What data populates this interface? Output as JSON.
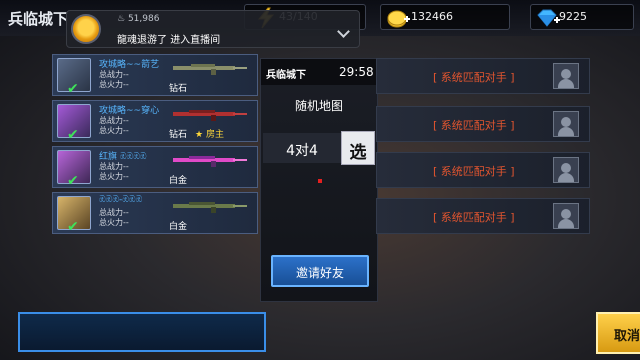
{
  "header": {
    "title": "兵临城下",
    "resources": {
      "stamina": "43/140",
      "gold": "132466",
      "diamond": "9225"
    },
    "resource_icons": [
      "lightning-icon",
      "gold-coin-icon",
      "diamond-icon"
    ]
  },
  "notification": {
    "viewer_count": "51,986",
    "user": "龍魂退游了",
    "action": "进入直播间"
  },
  "players": [
    {
      "name": "攻城略~~箭艺",
      "power_label": "总战力--",
      "fire_label": "总火力--",
      "rank": "钻石",
      "host": ""
    },
    {
      "name": "攻城略~~穿心",
      "power_label": "总战力--",
      "fire_label": "总火力--",
      "rank": "钻石",
      "host": "房主"
    },
    {
      "name": "红旗 ඹඹඹඹ",
      "power_label": "总战力--",
      "fire_label": "总火力--",
      "rank": "白金",
      "host": ""
    },
    {
      "name": "ඹඹඹ-ඹඹඹ",
      "power_label": "总战力--",
      "fire_label": "总火力--",
      "rank": "白金",
      "host": ""
    }
  ],
  "slots": [
    {
      "label": "[ 系统匹配对手 ]"
    },
    {
      "label": "[ 系统匹配对手 ]"
    },
    {
      "label": "[ 系统匹配对手 ]"
    },
    {
      "label": "[ 系统匹配对手 ]"
    }
  ],
  "map": {
    "name": "兵临城下",
    "timer": "29:58",
    "type": "随机地图",
    "mode": "4对4",
    "select_label": "选",
    "invite_label": "邀请好友"
  },
  "footer": {
    "cancel_label": "取消"
  },
  "colors": {
    "accent_blue": "#2c71c9",
    "slot_text": "#e2552f",
    "host_gold": "#ffd83a",
    "check_green": "#3fe25a"
  }
}
